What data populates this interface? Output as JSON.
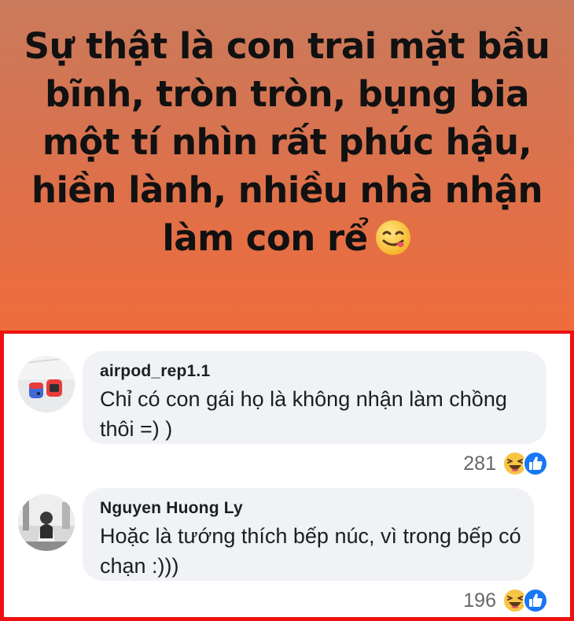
{
  "post": {
    "text": "Sự thật là con trai mặt bầu bĩnh, tròn tròn, bụng bia một tí nhìn rất phúc hậu, hiền lành, nhiều nhà nhận làm con rể",
    "emoji": "savoring-food-emoji"
  },
  "comments": [
    {
      "author": "airpod_rep1.1",
      "text": "Chỉ có con gái họ là không nhận làm chồng thôi =)  )",
      "reaction_count": "281",
      "reactions": [
        "haha-icon",
        "like-icon"
      ]
    },
    {
      "author": "Nguyen Huong Ly",
      "text": "Hoặc là tướng thích bếp núc, vì trong bếp có chạn :)))",
      "reaction_count": "196",
      "reactions": [
        "haha-icon",
        "like-icon"
      ]
    }
  ],
  "colors": {
    "highlight_border": "#ee1111",
    "bubble": "#f0f2f5",
    "banner_top": "#c97a5c",
    "banner_bottom": "#ef6c3c",
    "like_blue": "#1877f2",
    "haha_yellow": "#f7c544"
  }
}
